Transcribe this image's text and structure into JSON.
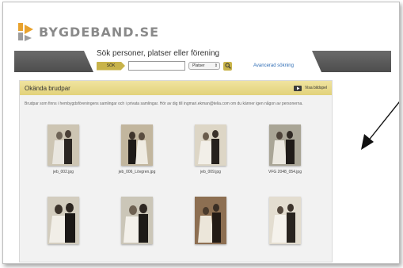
{
  "site": {
    "logo_text": "BYGDEBAND.SE",
    "logo_colors": [
      "#e8a22e",
      "#9c9c9c"
    ]
  },
  "search": {
    "heading": "Sök personer, platser eller förening",
    "button_label": "SÖK",
    "input_value": "",
    "select_value": "Platser",
    "advanced_link": "Avancerad sökning"
  },
  "panel": {
    "title": "Okända brudpar",
    "slideshow_label": "Visa bildspel",
    "description": "Brudpar som finns i hembygdsföreningens samlingar och i privata samlingar. Hör av dig till ingmari.ekman@telia.com om du känner igen någon av personerna."
  },
  "photos": [
    {
      "caption": "jeb_002.jpg"
    },
    {
      "caption": "jeb_006_Lövgren.jpg"
    },
    {
      "caption": "jeb_009.jpg"
    },
    {
      "caption": "VFG 2048_054.jpg"
    },
    {
      "caption": ""
    },
    {
      "caption": ""
    },
    {
      "caption": ""
    },
    {
      "caption": ""
    }
  ],
  "colors": {
    "accent": "#c8b34a",
    "band": "#555555",
    "panel_header": "#e9db8c",
    "link": "#2f6db5"
  }
}
